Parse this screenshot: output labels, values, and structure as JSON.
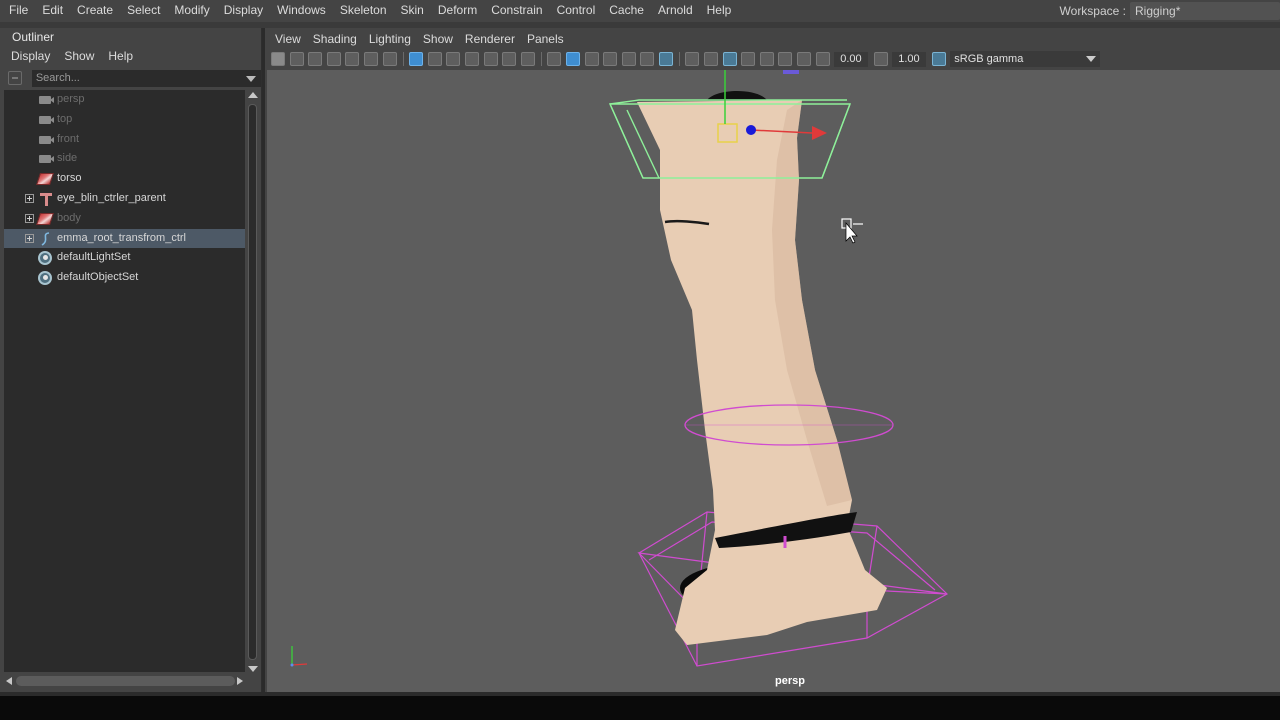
{
  "menubar": {
    "items": [
      "File",
      "Edit",
      "Create",
      "Select",
      "Modify",
      "Display",
      "Windows",
      "Skeleton",
      "Skin",
      "Deform",
      "Constrain",
      "Control",
      "Cache",
      "Arnold",
      "Help"
    ]
  },
  "workspace": {
    "label": "Workspace :",
    "value": "Rigging*"
  },
  "outliner": {
    "tab": "Outliner",
    "menus": [
      "Display",
      "Show",
      "Help"
    ],
    "search_placeholder": "Search...",
    "items": [
      {
        "label": "persp",
        "icon": "camera-icon",
        "dim": true
      },
      {
        "label": "top",
        "icon": "camera-icon",
        "dim": true
      },
      {
        "label": "front",
        "icon": "camera-icon",
        "dim": true
      },
      {
        "label": "side",
        "icon": "camera-icon",
        "dim": true
      },
      {
        "label": "torso",
        "icon": "mesh-icon",
        "dim": false
      },
      {
        "label": "eye_blin_ctrler_parent",
        "icon": "joint-icon",
        "dim": false
      },
      {
        "label": "body",
        "icon": "mesh-icon",
        "dim": true
      },
      {
        "label": "emma_root_transfrom_ctrl",
        "icon": "curve-icon",
        "dim": false,
        "selected": true
      },
      {
        "label": "defaultLightSet",
        "icon": "set-icon",
        "dim": false
      },
      {
        "label": "defaultObjectSet",
        "icon": "set-icon",
        "dim": false
      }
    ]
  },
  "viewport": {
    "menus": [
      "View",
      "Shading",
      "Lighting",
      "Show",
      "Renderer",
      "Panels"
    ],
    "exposure": "0.00",
    "gamma": "1.00",
    "colorspace": "sRGB gamma",
    "camera_label": "persp"
  },
  "colors": {
    "ui_bg": "#444444",
    "viewport_bg": "#5d5d5d",
    "selection": "#4d5966",
    "skin": "#e8cdb4",
    "controller_green": "#8ef09a",
    "controller_magenta": "#d04cd0"
  }
}
